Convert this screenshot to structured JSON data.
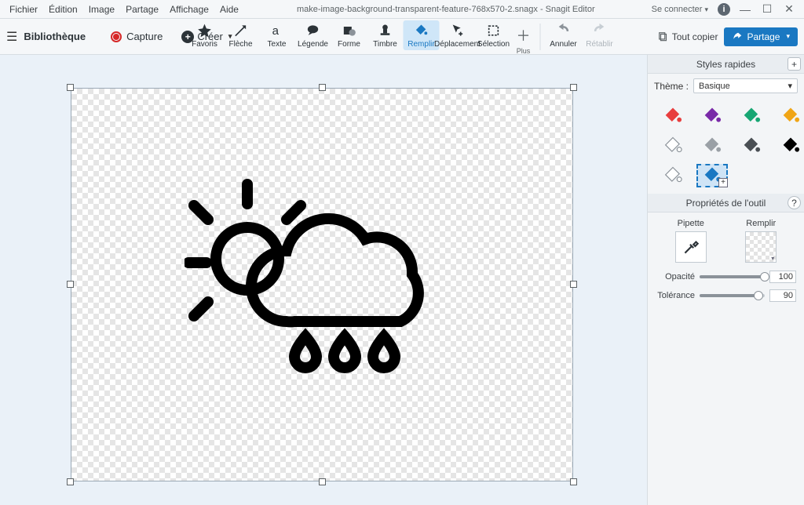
{
  "menu": {
    "file": "Fichier",
    "edit": "Édition",
    "image": "Image",
    "share": "Partage",
    "view": "Affichage",
    "help": "Aide"
  },
  "title": "make-image-background-transparent-feature-768x570-2.snagx - Snagit Editor",
  "signin": "Se connecter",
  "library": "Bibliothèque",
  "capture": "Capture",
  "create": "Créer",
  "tools": {
    "favorites": "Favoris",
    "arrow": "Flèche",
    "text": "Texte",
    "callout": "Légende",
    "shape": "Forme",
    "stamp": "Timbre",
    "fill": "Remplir",
    "move": "Déplacement",
    "selection": "Sélection",
    "more": "Plus",
    "undo": "Annuler",
    "redo": "Rétablir"
  },
  "copy_all": "Tout copier",
  "share_btn": "Partage",
  "panel": {
    "styles": "Styles rapides",
    "theme_label": "Thème :",
    "theme_value": "Basique",
    "props": "Propriétés de l'outil",
    "pipette": "Pipette",
    "fill": "Remplir",
    "opacity": "Opacité",
    "tolerance": "Tolérance",
    "opacity_val": "100",
    "tolerance_val": "90"
  },
  "swatch_colors": [
    "#e83e3e",
    "#7a2aa8",
    "#17a673",
    "#f0a516",
    "#ffffff",
    "#9aa0a6",
    "#4a4f54",
    "#000000",
    "#ffffff",
    "#1a78c2"
  ]
}
